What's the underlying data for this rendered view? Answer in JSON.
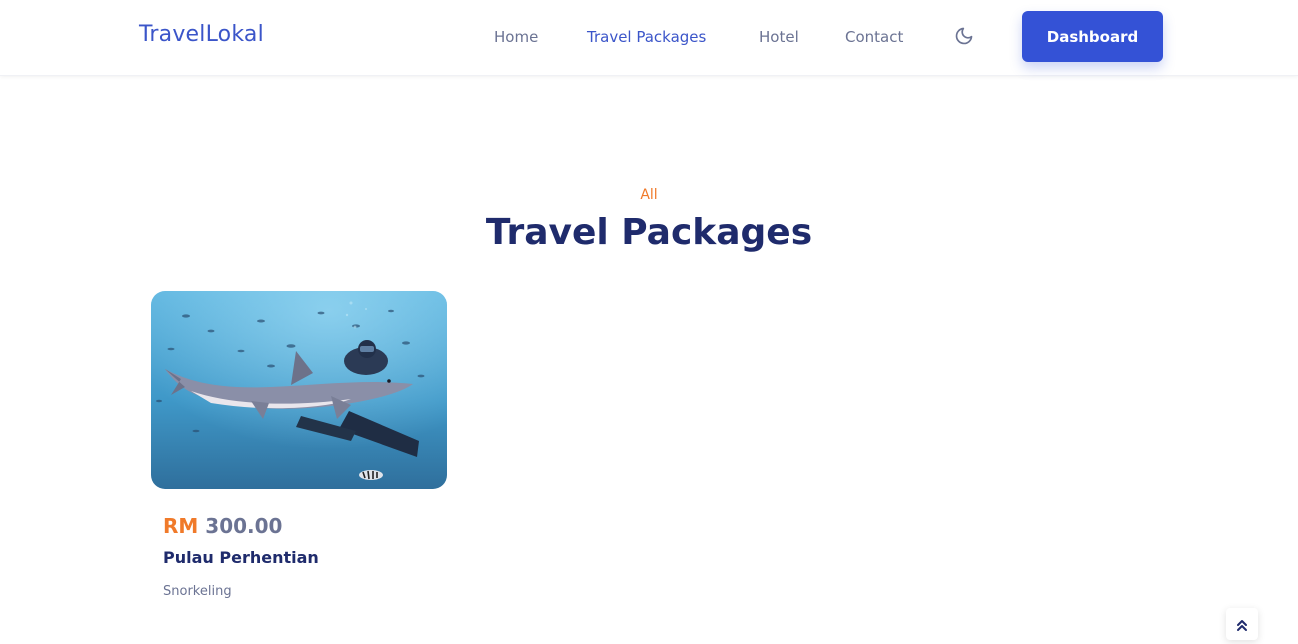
{
  "header": {
    "logo": "TravelLokal",
    "nav": [
      {
        "label": "Home"
      },
      {
        "label": "Travel Packages",
        "active": true
      },
      {
        "label": "Hotel"
      },
      {
        "label": "Contact"
      }
    ],
    "theme_toggle_icon": "moon-icon",
    "dashboard_label": "Dashboard"
  },
  "section": {
    "subtitle": "All",
    "title": "Travel Packages"
  },
  "packages": [
    {
      "image": "shark-snorkeling-photo",
      "currency": "RM",
      "price": "300.00",
      "title": "Pulau Perhentian",
      "category": "Snorkeling"
    }
  ],
  "scroll_top_icon": "chevron-double-up-icon",
  "colors": {
    "brand": "#3b55c9",
    "button": "#3452d6",
    "accent": "#f07a2a",
    "heading": "#1f2b6c",
    "muted": "#6b7393"
  }
}
